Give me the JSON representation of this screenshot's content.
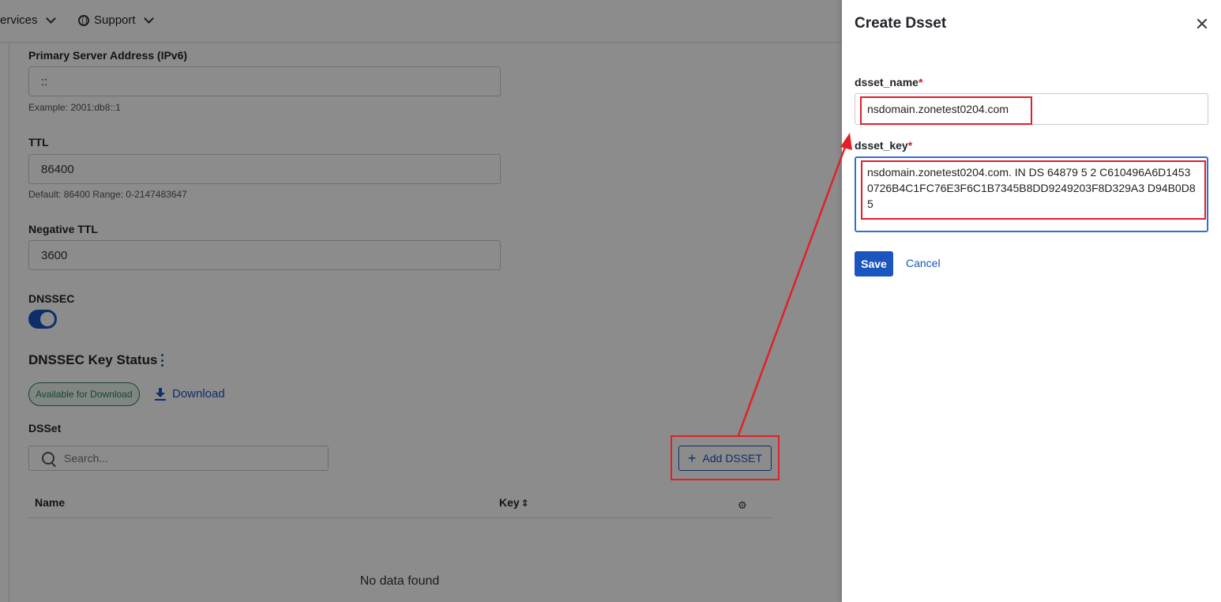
{
  "topbar": {
    "services_label": "ervices",
    "support_label": "Support"
  },
  "form": {
    "ipv6_label": "Primary Server Address (IPv6)",
    "ipv6_value": "::",
    "ipv6_hint": "Example: 2001:db8::1",
    "ttl_label": "TTL",
    "ttl_value": "86400",
    "ttl_hint": "Default: 86400 Range: 0-2147483647",
    "neg_ttl_label": "Negative TTL",
    "neg_ttl_value": "3600",
    "dnssec_label": "DNSSEC",
    "dnssec_enabled": true
  },
  "dnssec_status": {
    "title": "DNSSEC Key Status",
    "badge": "Available for Download",
    "download_label": "Download"
  },
  "dsset": {
    "label": "DSSet",
    "search_placeholder": "Search...",
    "add_button": "Add DSSET",
    "columns": [
      "Name",
      "Key"
    ],
    "sort_glyph": "⇕",
    "empty_text": "No data found"
  },
  "drawer": {
    "title": "Create Dsset",
    "name_label": "dsset_name",
    "required_mark": "*",
    "name_value": "nsdomain.zonetest0204.com",
    "key_label": "dsset_key",
    "key_value": "nsdomain.zonetest0204.com. IN DS 64879 5 2 C610496A6D14530726B4C1FC76E3F6C1B7345B8DD9249203F8D329A3 D94B0D85",
    "save_label": "Save",
    "cancel_label": "Cancel"
  },
  "colors": {
    "primary": "#1a55c0",
    "annotation": "#e0202a",
    "success": "#2e7d4f"
  }
}
